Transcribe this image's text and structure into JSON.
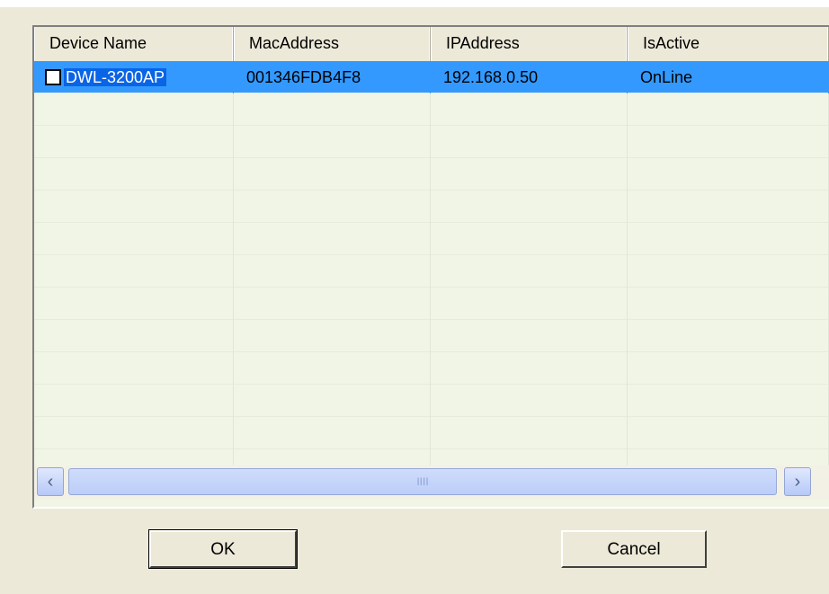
{
  "columns": [
    "Device Name",
    "MacAddress",
    "IPAddress",
    "IsActive"
  ],
  "rows": [
    {
      "device_name": "DWL-3200AP",
      "mac": "001346FDB4F8",
      "ip": "192.168.0.50",
      "status": "OnLine",
      "checked": false,
      "selected": true
    }
  ],
  "scrollbar": {
    "thumb_grip": "IIII",
    "left_arrow": "‹",
    "right_arrow": "›"
  },
  "buttons": {
    "ok": "OK",
    "cancel": "Cancel"
  },
  "colors": {
    "selection": "#3399ff",
    "list_background": "#f0f5e6",
    "dialog_background": "#ece9d8"
  }
}
